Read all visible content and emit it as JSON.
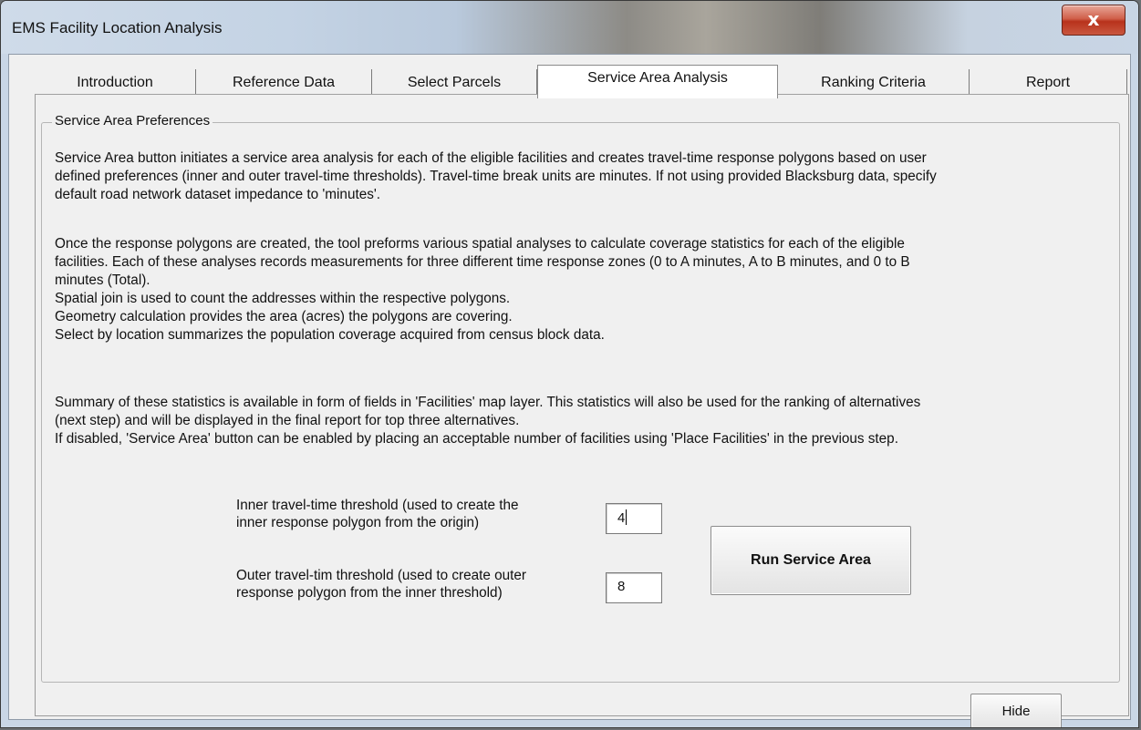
{
  "window": {
    "title": "EMS Facility Location Analysis",
    "close_glyph": "x"
  },
  "tabs": [
    {
      "label": "Introduction"
    },
    {
      "label": "Reference Data"
    },
    {
      "label": "Select Parcels"
    },
    {
      "label": "Service Area Analysis",
      "active": true
    },
    {
      "label": "Ranking Criteria"
    },
    {
      "label": "Report"
    }
  ],
  "group": {
    "label": "Service Area Preferences",
    "para1": "Service Area button initiates a service area analysis for each of the eligible facilities and creates travel-time response polygons based on user\ndefined preferences (inner and outer travel-time thresholds). Travel-time break units are minutes. If not using provided Blacksburg data, specify\ndefault road network dataset impedance to 'minutes'.",
    "para2": "Once the response polygons are created, the tool preforms various spatial analyses to calculate coverage statistics for each of the eligible\nfacilities. Each of these analyses records measurements for three different time response zones (0 to A minutes, A to B minutes, and 0 to B\nminutes (Total).\nSpatial join is used to count the addresses within the respective polygons.\nGeometry calculation provides the area (acres) the polygons are covering.\nSelect by location summarizes the population coverage acquired from census block data.",
    "para3": "Summary of these statistics is available in form of fields in 'Facilities' map layer. This statistics will also be used for the ranking of alternatives\n(next step) and will be displayed in the final report for top three alternatives.\nIf disabled, 'Service Area' button can be enabled by placing an acceptable number of facilities using 'Place Facilities' in the previous step.",
    "inner_label": "Inner travel-time threshold (used to create the\ninner response polygon from the origin)",
    "inner_value": "4",
    "outer_label": "Outer travel-tim threshold (used to create outer\nresponse polygon from the inner threshold)",
    "outer_value": "8",
    "run_button": "Run Service Area"
  },
  "hide_button": "Hide"
}
